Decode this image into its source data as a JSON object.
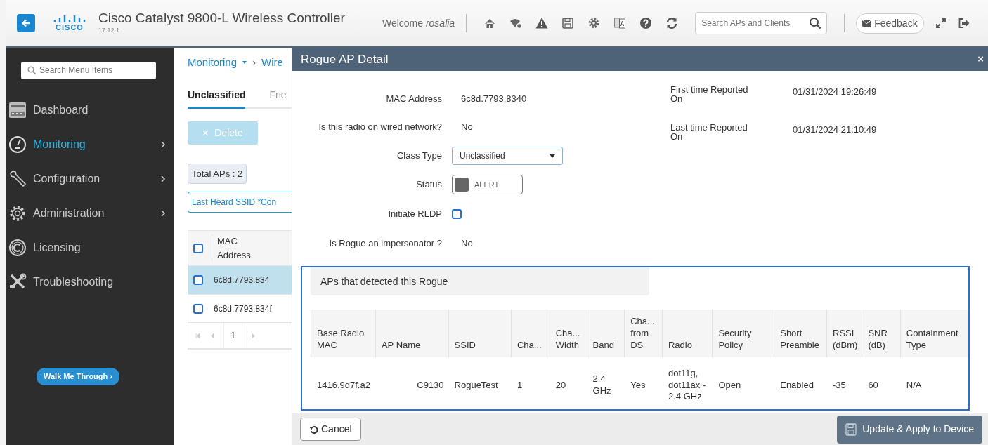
{
  "header": {
    "logo_text": "CISCO",
    "title": "Cisco Catalyst 9800-L Wireless Controller",
    "version": "17.12.1",
    "welcome": "Welcome",
    "user": "rosalia",
    "search": {
      "placeholder": "Search APs and Clients"
    },
    "feedback": "Feedback"
  },
  "sidebar": {
    "search": {
      "placeholder": "Search Menu Items"
    },
    "items": [
      {
        "label": "Dashboard",
        "selected": false,
        "has_submenu": false
      },
      {
        "label": "Monitoring",
        "selected": true,
        "has_submenu": true
      },
      {
        "label": "Configuration",
        "selected": false,
        "has_submenu": true
      },
      {
        "label": "Administration",
        "selected": false,
        "has_submenu": true
      },
      {
        "label": "Licensing",
        "selected": false,
        "has_submenu": false
      },
      {
        "label": "Troubleshooting",
        "selected": false,
        "has_submenu": false
      }
    ],
    "walk_me_through": "Walk Me Through ›"
  },
  "page": {
    "separator": "›",
    "breadcrumb": [
      {
        "label": "Monitoring",
        "dropdown": true
      },
      {
        "label": "Wire",
        "dropdown": false
      }
    ],
    "tabs": [
      {
        "label": "Unclassified",
        "selected": true
      },
      {
        "label": "Frie",
        "selected": false
      }
    ],
    "delete_button": {
      "label": "Delete",
      "disabled": true
    },
    "total": "Total APs : 2",
    "filter": "Last Heard SSID *Con",
    "table": {
      "header_checked": false,
      "column": "MAC Address",
      "rows": [
        {
          "mac": "6c8d.7793.834",
          "selected": true,
          "checked": false
        },
        {
          "mac": "6c8d.7793.834f",
          "selected": false,
          "checked": false
        }
      ],
      "page": "1"
    }
  },
  "modal": {
    "title": "Rogue AP Detail",
    "close": "×",
    "left_fields": [
      {
        "kind": "text",
        "label": "MAC Address",
        "value": "6c8d.7793.8340"
      },
      {
        "kind": "text",
        "label": "Is this radio on wired network?",
        "value": "No"
      },
      {
        "kind": "select",
        "label": "Class Type",
        "value": "Unclassified"
      },
      {
        "kind": "toggle",
        "label": "Status",
        "value": "ALERT",
        "on": false
      },
      {
        "kind": "checkbox",
        "label": "Initiate RLDP",
        "checked": false
      },
      {
        "kind": "text",
        "label": "Is Rogue an impersonator ?",
        "value": "No"
      }
    ],
    "right_fields": [
      {
        "label": "First time Reported On",
        "value": "01/31/2024 19:26:49"
      },
      {
        "label": "Last time Reported On",
        "value": "01/31/2024 21:10:49"
      }
    ],
    "detected": {
      "title": "APs that detected this Rogue",
      "columns": [
        "Base Radio MAC",
        "AP Name",
        "SSID",
        "Cha...",
        "Cha... Width",
        "Band",
        "Cha... from DS",
        "Radio",
        "Security Policy",
        "Short Preamble",
        "RSSI (dBm)",
        "SNR (dB)",
        "Containment Type"
      ],
      "rows": [
        [
          "1416.9d7f.a2",
          "C9130",
          "RogueTest",
          "1",
          "20",
          "2.4 GHz",
          "Yes",
          "dot11g, dot11ax - 2.4 GHz",
          "Open",
          "Enabled",
          "-35",
          "60",
          "N/A"
        ]
      ]
    },
    "cancel": "Cancel",
    "apply": "Update & Apply to Device"
  }
}
